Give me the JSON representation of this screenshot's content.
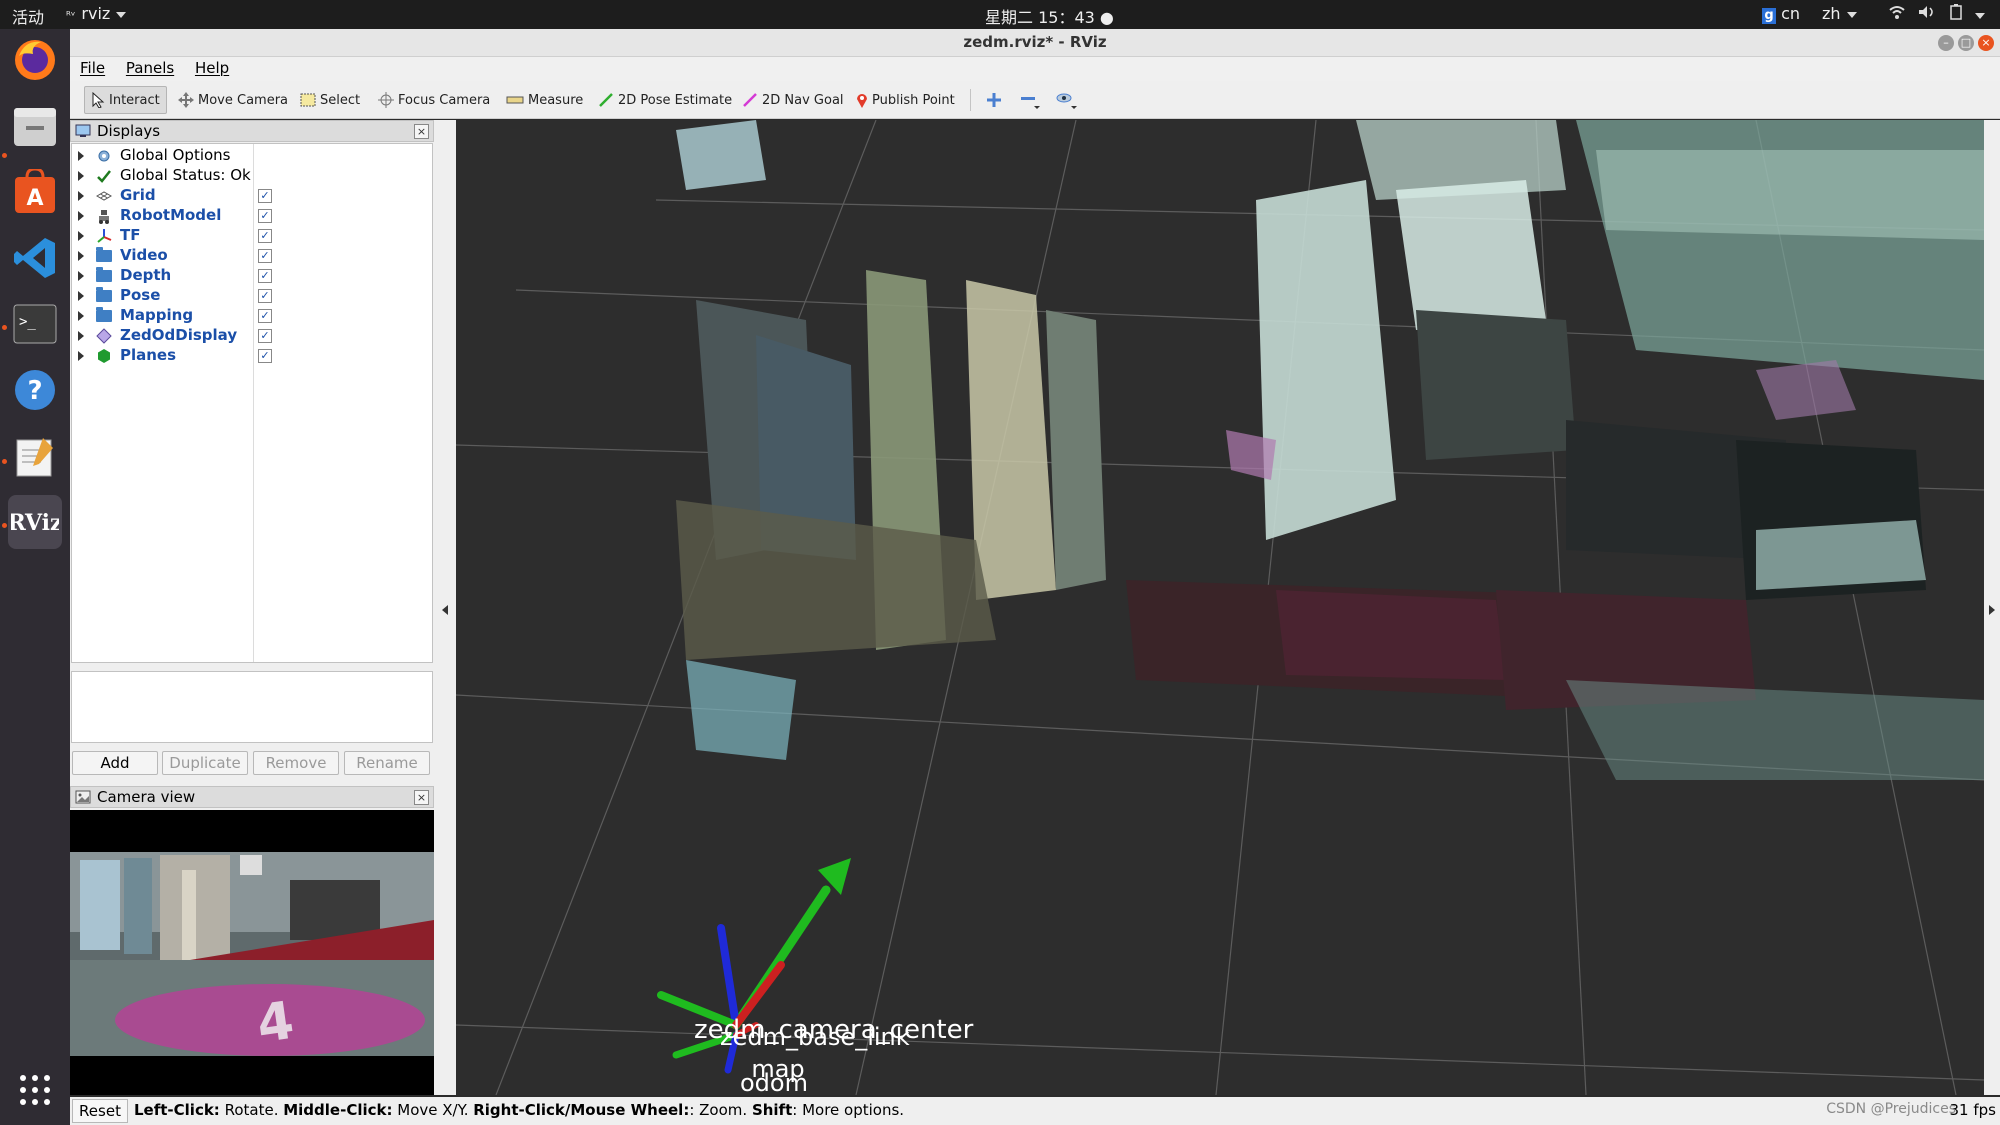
{
  "topbar": {
    "activities": "活动",
    "app_name": "rviz",
    "clock": "星期二 15：43",
    "input_method": "cn",
    "language": "zh"
  },
  "window": {
    "title": "zedm.rviz* - RViz"
  },
  "menu": {
    "file": "File",
    "panels": "Panels",
    "help": "Help"
  },
  "toolbar": {
    "interact": "Interact",
    "move_camera": "Move Camera",
    "select": "Select",
    "focus_camera": "Focus Camera",
    "measure": "Measure",
    "pose_estimate": "2D Pose Estimate",
    "nav_goal": "2D Nav Goal",
    "publish_point": "Publish Point"
  },
  "displays_panel": {
    "title": "Displays",
    "items": [
      {
        "label": "Global Options"
      },
      {
        "label": "Global Status: Ok"
      },
      {
        "label": "Grid",
        "checked": true
      },
      {
        "label": "RobotModel",
        "checked": true
      },
      {
        "label": "TF",
        "checked": true
      },
      {
        "label": "Video",
        "checked": true
      },
      {
        "label": "Depth",
        "checked": true
      },
      {
        "label": "Pose",
        "checked": true
      },
      {
        "label": "Mapping",
        "checked": true
      },
      {
        "label": "ZedOdDisplay",
        "checked": true
      },
      {
        "label": "Planes",
        "checked": true
      }
    ],
    "buttons": {
      "add": "Add",
      "duplicate": "Duplicate",
      "remove": "Remove",
      "rename": "Rename"
    }
  },
  "camera_panel": {
    "title": "Camera view",
    "floor_digit": "4"
  },
  "viewport": {
    "frame_label_1": "zedm_camera_center",
    "frame_label_2": "zedm_base_link",
    "frame_label_3": "odom",
    "frame_label_4": "map"
  },
  "status": {
    "reset": "Reset",
    "help_parts": [
      {
        "bold": "Left-Click:",
        "text": " Rotate. "
      },
      {
        "bold": "Middle-Click:",
        "text": " Move X/Y. "
      },
      {
        "bold": "Right-Click/Mouse Wheel:",
        "text": ": Zoom. "
      },
      {
        "bold": "Shift",
        "text": ": More options."
      }
    ],
    "fps": "31 fps"
  },
  "watermark": "CSDN @Prejudices"
}
